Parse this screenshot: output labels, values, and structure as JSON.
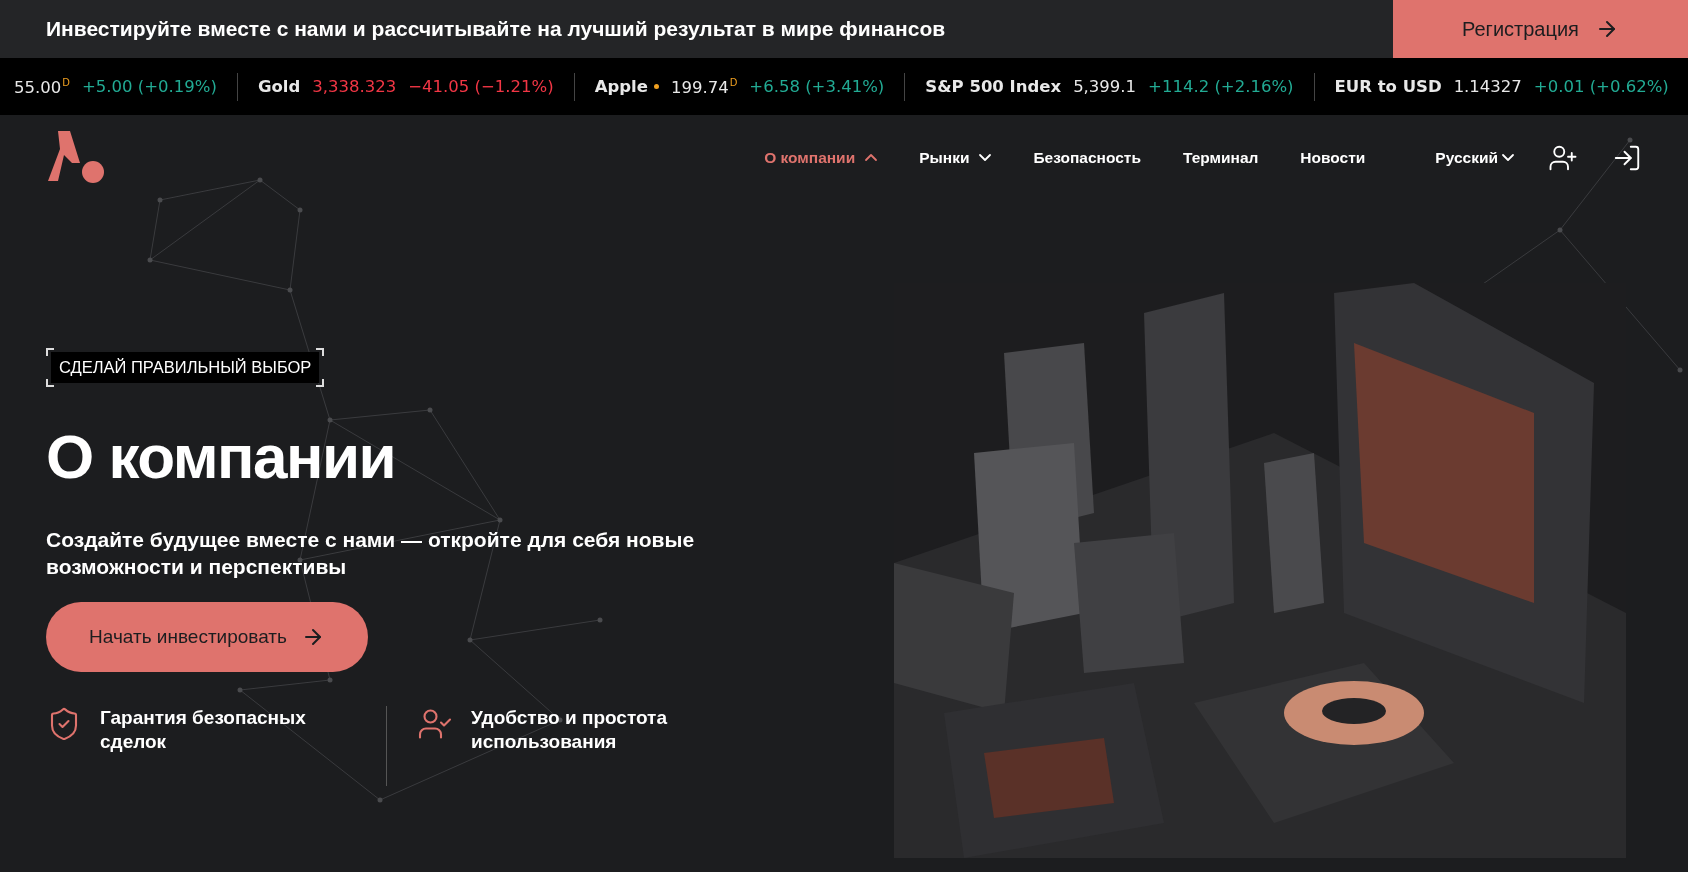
{
  "banner": {
    "text": "Инвестируйте вместе с нами и рассчитывайте на лучший результат в мире финансов",
    "button": "Регистрация"
  },
  "ticker": [
    {
      "dot": false,
      "price": "55.00",
      "mark": "D",
      "change": "+5.00 (+0.19%)",
      "falling": false,
      "price_tinted": false
    },
    {
      "name": "Gold",
      "dot": false,
      "price": "3,338.323",
      "change": "−41.05 (−1.21%)",
      "falling": true,
      "price_tinted": true
    },
    {
      "name": "Apple",
      "dot": true,
      "price": "199.74",
      "mark": "D",
      "change": "+6.58 (+3.41%)",
      "falling": false,
      "price_tinted": false
    },
    {
      "name": "S&P 500 Index",
      "dot": false,
      "price": "5,399.1",
      "change": "+114.2 (+2.16%)",
      "falling": false,
      "price_tinted": false
    },
    {
      "name": "EUR to USD",
      "dot": false,
      "price": "1.14327",
      "change": "+0.01 (+0.62%)",
      "falling": false,
      "price_tinted": false
    }
  ],
  "nav": {
    "items": [
      {
        "label": "О компании",
        "selected": true,
        "dropdown": true
      },
      {
        "label": "Рынки",
        "selected": false,
        "dropdown": true
      },
      {
        "label": "Безопасность",
        "selected": false,
        "dropdown": false
      },
      {
        "label": "Терминал",
        "selected": false,
        "dropdown": false
      },
      {
        "label": "Новости",
        "selected": false,
        "dropdown": false
      }
    ],
    "language": "Русский"
  },
  "hero": {
    "tag": "СДЕЛАЙ ПРАВИЛЬНЫЙ ВЫБОР",
    "title": "О компании",
    "subtitle": "Создайте будущее вместе с нами — откройте для себя новые возможности и перспективы",
    "button": "Начать инвестировать",
    "features": [
      {
        "kind": "shield",
        "text": "Гарантия безопасных сделок"
      },
      {
        "kind": "user",
        "text": "Удобство и простота использования"
      }
    ]
  }
}
